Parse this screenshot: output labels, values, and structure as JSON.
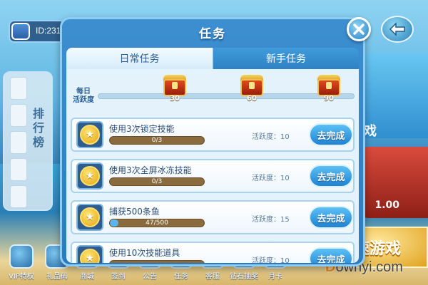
{
  "player": {
    "id_text": "ID:231"
  },
  "rank": {
    "label": "排行榜"
  },
  "side": {
    "fish_label": "戏",
    "price": "1.00"
  },
  "quick_game": {
    "label": "速游戏"
  },
  "bottom_bar": [
    {
      "label": "VIP特权",
      "icon": "vip-icon"
    },
    {
      "label": "礼品码",
      "icon": "gift-icon"
    },
    {
      "label": "商城",
      "icon": "shop-icon"
    },
    {
      "label": "签到",
      "icon": "sign-in-icon"
    },
    {
      "label": "公告",
      "icon": "notice-icon"
    },
    {
      "label": "任务",
      "icon": "task-icon"
    },
    {
      "label": "客服",
      "icon": "service-icon"
    },
    {
      "label": "钻石抽奖",
      "icon": "diamond-icon"
    },
    {
      "label": "月卡",
      "icon": "card-icon"
    }
  ],
  "watermark": {
    "brand": "D",
    "rest": "ownyi.com"
  },
  "dialog": {
    "title": "任务",
    "tabs": [
      {
        "label": "日常任务",
        "active": true
      },
      {
        "label": "新手任务",
        "active": false
      }
    ],
    "daily_label": "每日\n活跃度",
    "activity_progress": 0,
    "chests": [
      {
        "value": "30",
        "threshold": 30
      },
      {
        "value": "60",
        "threshold": 60
      },
      {
        "value": "90",
        "threshold": 90
      }
    ],
    "tasks": [
      {
        "name": "使用3次锁定技能",
        "progress_text": "0/3",
        "progress": 0,
        "activity": "活跃度：10",
        "button": "去完成"
      },
      {
        "name": "使用3次全屏冰冻技能",
        "progress_text": "0/3",
        "progress": 0,
        "activity": "活跃度：10",
        "button": "去完成"
      },
      {
        "name": "捕获500条鱼",
        "progress_text": "47/500",
        "progress": 0.094,
        "activity": "活跃度：15",
        "button": "去完成"
      },
      {
        "name": "使用10次技能道具",
        "progress_text": "",
        "progress": 0,
        "activity": "活跃度：10",
        "button": "去完成"
      }
    ]
  },
  "colors": {
    "dialog_bg": "#3c8fd0",
    "button_blue": "#1f82d2",
    "coin_gold": "#e3a612",
    "chest_red": "#c4361a"
  }
}
